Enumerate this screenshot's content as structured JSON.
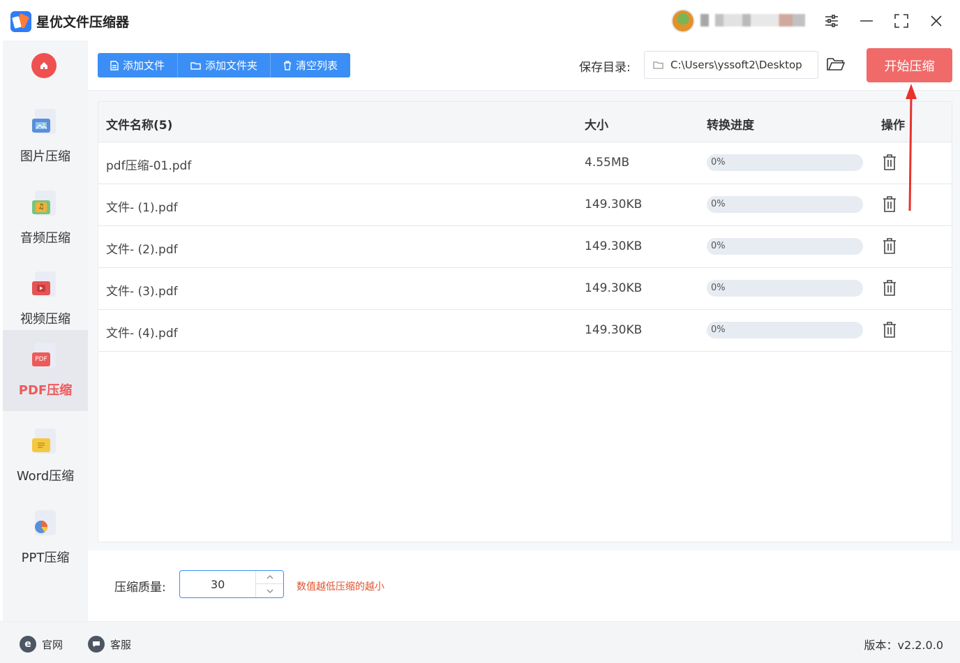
{
  "app": {
    "title": "星优文件压缩器"
  },
  "window_controls": [
    "settings-icon",
    "minimize-icon",
    "maximize-icon",
    "close-icon"
  ],
  "sidebar": {
    "items": [
      {
        "label": "图片压缩",
        "icon": "image-icon",
        "color": "#5b8fd9"
      },
      {
        "label": "音频压缩",
        "icon": "music-icon",
        "color": "#f2b134"
      },
      {
        "label": "视频压缩",
        "icon": "video-icon",
        "color": "#e55353"
      },
      {
        "label": "PDF压缩",
        "icon": "pdf-icon",
        "color": "#ee5a5a",
        "active": true
      },
      {
        "label": "Word压缩",
        "icon": "word-icon",
        "color": "#f5c842"
      },
      {
        "label": "PPT压缩",
        "icon": "ppt-icon",
        "color": "#e86a3a"
      }
    ]
  },
  "toolbar": {
    "add_file": "添加文件",
    "add_folder": "添加文件夹",
    "clear_list": "清空列表",
    "save_dir_label": "保存目录:",
    "save_dir_value": "C:\\Users\\yssoft2\\Desktop",
    "start_label": "开始压缩"
  },
  "table": {
    "columns": [
      "文件名称(5)",
      "大小",
      "转换进度",
      "操作"
    ],
    "rows": [
      {
        "name": "pdf压缩-01.pdf",
        "size": "4.55MB",
        "progress": "0%"
      },
      {
        "name": "文件- (1).pdf",
        "size": "149.30KB",
        "progress": "0%"
      },
      {
        "name": "文件- (2).pdf",
        "size": "149.30KB",
        "progress": "0%"
      },
      {
        "name": "文件- (3).pdf",
        "size": "149.30KB",
        "progress": "0%"
      },
      {
        "name": "文件- (4).pdf",
        "size": "149.30KB",
        "progress": "0%"
      }
    ]
  },
  "settings": {
    "quality_label": "压缩质量:",
    "quality_value": "30",
    "quality_hint": "数值越低压缩的越小"
  },
  "statusbar": {
    "website": "官网",
    "support": "客服",
    "version": "版本：v2.2.0.0"
  },
  "colors": {
    "accent": "#3a8ef6",
    "start_button": "#f06a6a",
    "active_sidebar_text": "#ee5a5a",
    "hint": "#e0542e"
  }
}
